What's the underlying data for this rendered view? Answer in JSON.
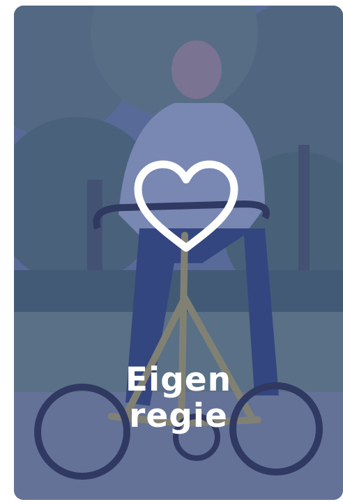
{
  "card": {
    "title_line1": "Eigen",
    "title_line2": "regie",
    "icon": "heart-outline-icon",
    "overlay_color": "#3a4c96",
    "text_color": "#ffffff"
  }
}
